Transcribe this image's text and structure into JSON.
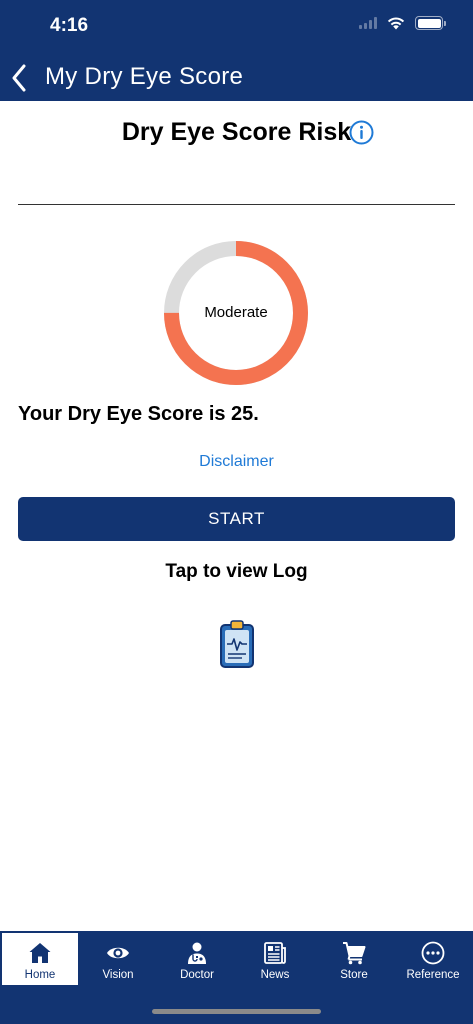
{
  "status_bar": {
    "time": "4:16"
  },
  "nav": {
    "title": "My Dry Eye Score"
  },
  "section": {
    "title": "Dry Eye Score Risk"
  },
  "gauge": {
    "label": "Moderate",
    "fill_fraction": 0.75,
    "fill_color": "#f47350",
    "track_color": "#dcdcdc"
  },
  "score": {
    "text": "Your Dry Eye Score is 25."
  },
  "links": {
    "disclaimer": "Disclaimer"
  },
  "actions": {
    "start_label": "START",
    "log_label": "Tap to view Log"
  },
  "tabbar": {
    "items": [
      {
        "label": "Home",
        "icon": "home-icon",
        "active": true
      },
      {
        "label": "Vision",
        "icon": "eye-icon",
        "active": false
      },
      {
        "label": "Doctor",
        "icon": "doctor-icon",
        "active": false
      },
      {
        "label": "News",
        "icon": "newspaper-icon",
        "active": false
      },
      {
        "label": "Store",
        "icon": "cart-icon",
        "active": false
      },
      {
        "label": "Reference",
        "icon": "more-icon",
        "active": false
      }
    ]
  },
  "colors": {
    "brand": "#123472",
    "accent": "#f47350",
    "link": "#1f7ad6"
  }
}
